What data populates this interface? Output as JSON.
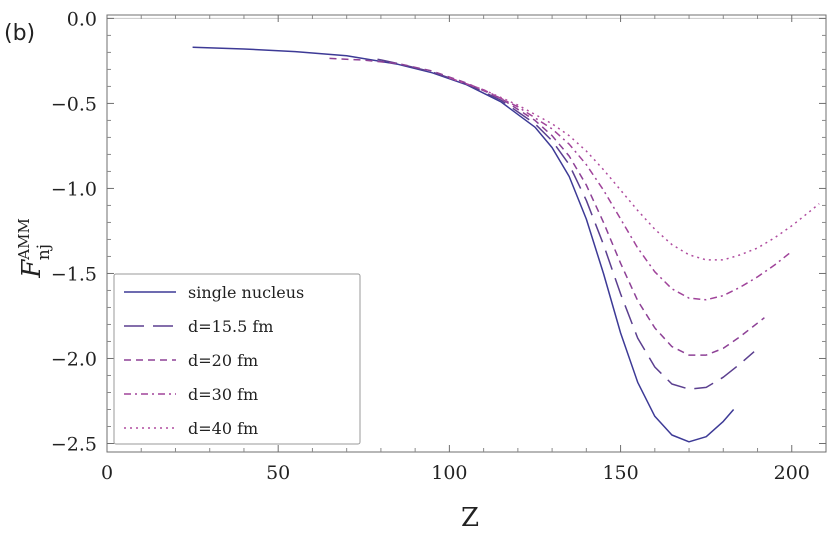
{
  "chart_data": {
    "type": "line",
    "panel_label": "(b)",
    "xlabel": "Z",
    "ylabel": {
      "main": "F",
      "superscript": "AMM",
      "subscript": "nj"
    },
    "xlim": [
      0,
      210
    ],
    "ylim": [
      -2.55,
      0.02
    ],
    "x_ticks": [
      0,
      50,
      100,
      150,
      200
    ],
    "x_tick_labels": [
      "0",
      "50",
      "100",
      "150",
      "200"
    ],
    "y_ticks": [
      0.0,
      -0.5,
      -1.0,
      -1.5,
      -2.0,
      -2.5
    ],
    "y_tick_labels": [
      "0.0",
      "−0.5",
      "−1.0",
      "−1.5",
      "−2.0",
      "−2.5"
    ],
    "grid": false,
    "reference_line_y": 0,
    "legend": "bottom-left",
    "series": [
      {
        "name": "single nucleus",
        "color": "#3d3a96",
        "dash": "solid",
        "x": [
          25,
          40,
          55,
          70,
          85,
          95,
          105,
          115,
          125,
          130,
          135,
          140,
          145,
          150,
          155,
          160,
          165,
          170,
          175,
          180,
          183
        ],
        "y": [
          -0.17,
          -0.18,
          -0.195,
          -0.22,
          -0.27,
          -0.32,
          -0.39,
          -0.49,
          -0.64,
          -0.76,
          -0.93,
          -1.18,
          -1.5,
          -1.85,
          -2.14,
          -2.34,
          -2.45,
          -2.49,
          -2.46,
          -2.37,
          -2.3
        ]
      },
      {
        "name": "d=15.5 fm",
        "color": "#5b3f8f",
        "dash": "long-dash",
        "x": [
          79,
          85,
          95,
          105,
          115,
          125,
          130,
          135,
          140,
          145,
          150,
          155,
          160,
          165,
          170,
          175,
          180,
          185,
          189
        ],
        "y": [
          -0.24,
          -0.265,
          -0.315,
          -0.385,
          -0.48,
          -0.62,
          -0.72,
          -0.86,
          -1.07,
          -1.33,
          -1.62,
          -1.88,
          -2.05,
          -2.15,
          -2.18,
          -2.17,
          -2.11,
          -2.03,
          -1.96
        ]
      },
      {
        "name": "d=20 fm",
        "color": "#8d4196",
        "dash": "dash",
        "x": [
          65,
          75,
          85,
          95,
          105,
          115,
          125,
          130,
          135,
          140,
          145,
          150,
          155,
          160,
          165,
          170,
          175,
          180,
          185,
          192
        ],
        "y": [
          -0.235,
          -0.245,
          -0.265,
          -0.31,
          -0.38,
          -0.47,
          -0.6,
          -0.69,
          -0.81,
          -0.98,
          -1.2,
          -1.44,
          -1.66,
          -1.82,
          -1.93,
          -1.98,
          -1.98,
          -1.94,
          -1.87,
          -1.76
        ]
      },
      {
        "name": "d=30 fm",
        "color": "#a0439a",
        "dash": "dash-dot",
        "x": [
          100,
          110,
          120,
          130,
          135,
          140,
          145,
          150,
          155,
          160,
          165,
          170,
          175,
          180,
          185,
          190,
          195,
          200
        ],
        "y": [
          -0.35,
          -0.42,
          -0.52,
          -0.65,
          -0.74,
          -0.86,
          -1.01,
          -1.18,
          -1.35,
          -1.49,
          -1.59,
          -1.645,
          -1.655,
          -1.63,
          -1.58,
          -1.52,
          -1.45,
          -1.37
        ]
      },
      {
        "name": "d=40 fm",
        "color": "#b04c9f",
        "dash": "dot",
        "x": [
          100,
          110,
          120,
          130,
          135,
          140,
          145,
          150,
          155,
          160,
          165,
          170,
          175,
          180,
          185,
          190,
          195,
          200,
          205,
          208
        ],
        "y": [
          -0.35,
          -0.42,
          -0.51,
          -0.62,
          -0.69,
          -0.78,
          -0.89,
          -1.01,
          -1.13,
          -1.24,
          -1.33,
          -1.39,
          -1.42,
          -1.42,
          -1.39,
          -1.35,
          -1.29,
          -1.22,
          -1.14,
          -1.09
        ]
      }
    ]
  }
}
